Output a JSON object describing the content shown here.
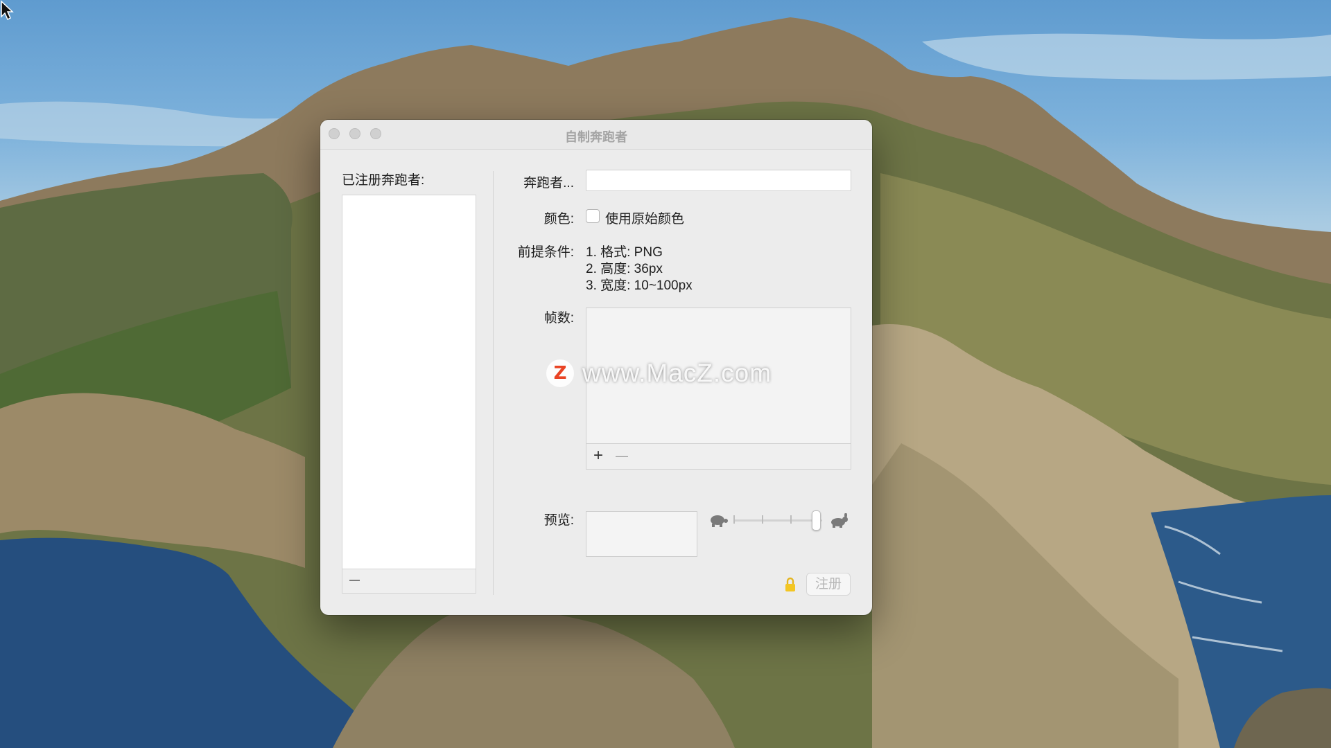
{
  "window": {
    "title": "自制奔跑者"
  },
  "registered": {
    "label": "已注册奔跑者:"
  },
  "form": {
    "runner_label": "奔跑者...",
    "runner_value": "",
    "color_label": "颜色:",
    "color_checkbox_label": "使用原始颜色",
    "color_checked": false,
    "prereq_label": "前提条件:",
    "prereq_lines": [
      "1. 格式:  PNG",
      "2. 高度:  36px",
      "3. 宽度:  10~100px"
    ],
    "frames_label": "帧数:",
    "frames_add": "+",
    "frames_remove": "—",
    "preview_label": "预览:",
    "speed_level": 1.0,
    "register_button": "注册"
  },
  "watermark": {
    "logo": "Z",
    "text": "www.MacZ.com"
  },
  "icons": {
    "slow": "turtle-icon",
    "fast": "rabbit-icon",
    "lock": "lock-icon",
    "cursor": "pointer-cursor-icon"
  },
  "colors": {
    "lock": "#f3c623",
    "watermark_logo": "#e94324"
  }
}
